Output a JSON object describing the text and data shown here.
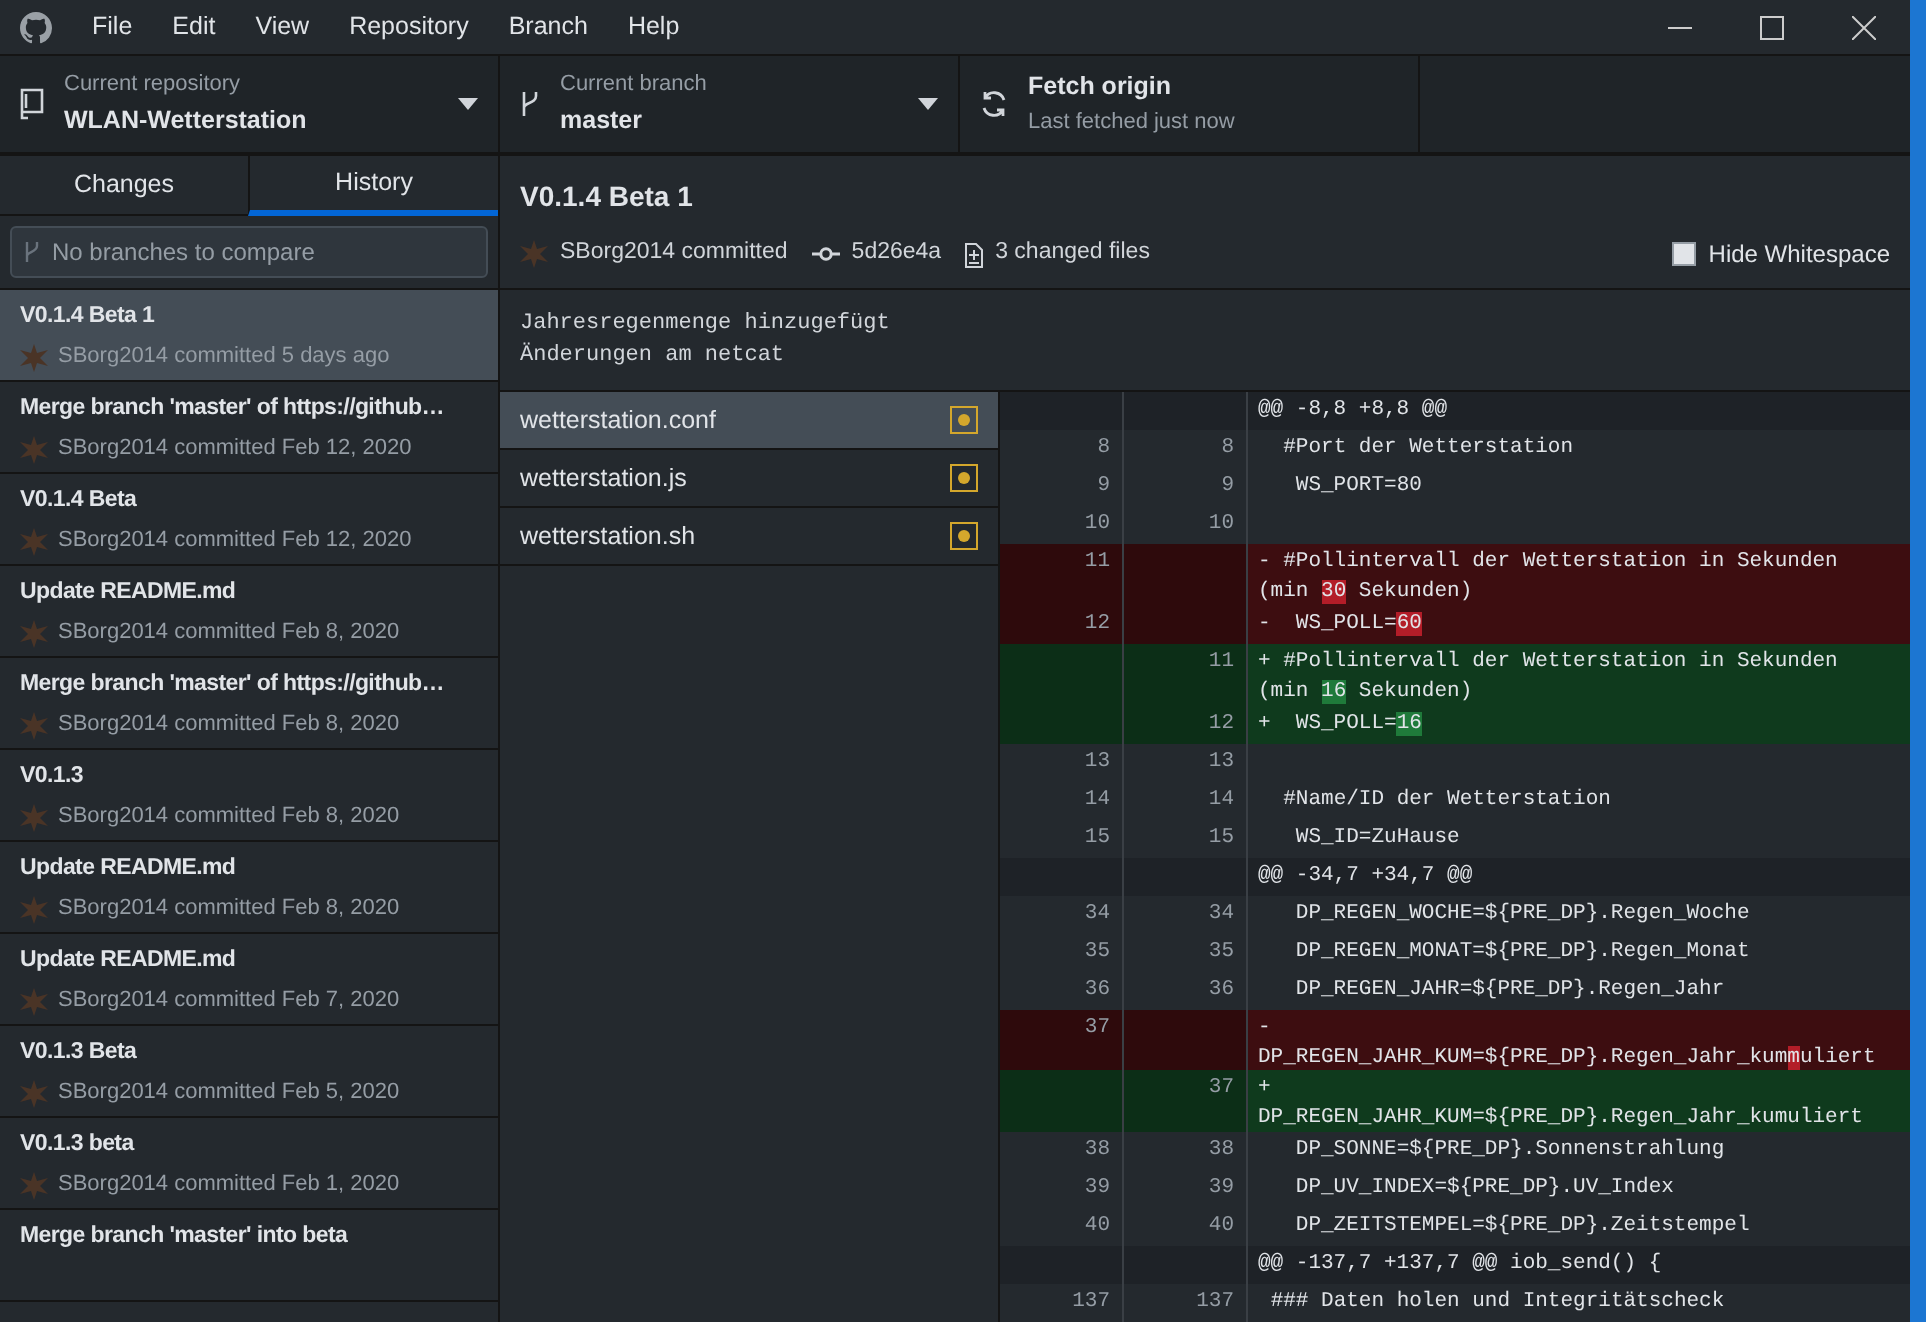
{
  "menu": [
    "File",
    "Edit",
    "View",
    "Repository",
    "Branch",
    "Help"
  ],
  "toolbar": {
    "repository": {
      "label": "Current repository",
      "value": "WLAN-Wetterstation"
    },
    "branch": {
      "label": "Current branch",
      "value": "master"
    },
    "fetch": {
      "title": "Fetch origin",
      "subtitle": "Last fetched just now"
    }
  },
  "tabs": [
    {
      "label": "Changes",
      "selected": false
    },
    {
      "label": "History",
      "selected": true
    }
  ],
  "branch_filter": {
    "placeholder": "No branches to compare"
  },
  "commits": [
    {
      "title": "V0.1.4 Beta 1",
      "meta": "SBorg2014 committed 5 days ago",
      "selected": true
    },
    {
      "title": "Merge branch 'master' of https://github…",
      "meta": "SBorg2014 committed Feb 12, 2020",
      "selected": false
    },
    {
      "title": "V0.1.4 Beta",
      "meta": "SBorg2014 committed Feb 12, 2020",
      "selected": false
    },
    {
      "title": "Update README.md",
      "meta": "SBorg2014 committed Feb 8, 2020",
      "selected": false
    },
    {
      "title": "Merge branch 'master' of https://github…",
      "meta": "SBorg2014 committed Feb 8, 2020",
      "selected": false
    },
    {
      "title": "V0.1.3",
      "meta": "SBorg2014 committed Feb 8, 2020",
      "selected": false
    },
    {
      "title": "Update README.md",
      "meta": "SBorg2014 committed Feb 8, 2020",
      "selected": false
    },
    {
      "title": "Update README.md",
      "meta": "SBorg2014 committed Feb 7, 2020",
      "selected": false
    },
    {
      "title": "V0.1.3 Beta",
      "meta": "SBorg2014 committed Feb 5, 2020",
      "selected": false
    },
    {
      "title": "V0.1.3 beta",
      "meta": "SBorg2014 committed Feb 1, 2020",
      "selected": false
    },
    {
      "title": "Merge branch 'master' into beta",
      "selected": false
    }
  ],
  "commit": {
    "title": "V0.1.4 Beta 1",
    "author": "SBorg2014 committed",
    "sha": "5d26e4a",
    "files_changed": "3 changed files",
    "hide_whitespace": {
      "label": "Hide Whitespace",
      "checked": false
    },
    "message_lines": [
      "Jahresregenmenge hinzugefügt",
      "Änderungen am netcat"
    ]
  },
  "files": [
    {
      "name": "wetterstation.conf",
      "selected": true
    },
    {
      "name": "wetterstation.js",
      "selected": false
    },
    {
      "name": "wetterstation.sh",
      "selected": false
    }
  ],
  "diff": [
    {
      "kind": "hunk",
      "text": "@@ -8,8 +8,8 @@"
    },
    {
      "kind": "context",
      "old": "8",
      "new": "8",
      "text": "  #Port der Wetterstation"
    },
    {
      "kind": "context",
      "old": "9",
      "new": "9",
      "text": "   WS_PORT=80"
    },
    {
      "kind": "context",
      "old": "10",
      "new": "10"
    },
    {
      "kind": "deleted",
      "old": "11",
      "parts": [
        {
          "text": "- #Pollintervall der Wetterstation in Sekunden (min ",
          "highlight": false
        },
        {
          "text": "30",
          "highlight": true
        },
        {
          "text": " Sekunden)",
          "highlight": false
        }
      ]
    },
    {
      "kind": "deleted",
      "old": "12",
      "parts": [
        {
          "text": "-  WS_POLL=",
          "highlight": false
        },
        {
          "text": "60",
          "highlight": true
        }
      ]
    },
    {
      "kind": "added",
      "new": "11",
      "parts": [
        {
          "text": "+ #Pollintervall der Wetterstation in Sekunden (min ",
          "highlight": false
        },
        {
          "text": "16",
          "highlight": true
        },
        {
          "text": " Sekunden)",
          "highlight": false
        }
      ]
    },
    {
      "kind": "added",
      "new": "12",
      "parts": [
        {
          "text": "+  WS_POLL=",
          "highlight": false
        },
        {
          "text": "16",
          "highlight": true
        }
      ]
    },
    {
      "kind": "context",
      "old": "13",
      "new": "13"
    },
    {
      "kind": "context",
      "old": "14",
      "new": "14",
      "text": "  #Name/ID der Wetterstation"
    },
    {
      "kind": "context",
      "old": "15",
      "new": "15",
      "text": "   WS_ID=ZuHause"
    },
    {
      "kind": "hunk",
      "text": "@@ -34,7 +34,7 @@"
    },
    {
      "kind": "context",
      "old": "34",
      "new": "34",
      "text": "   DP_REGEN_WOCHE=${PRE_DP}.Regen_Woche"
    },
    {
      "kind": "context",
      "old": "35",
      "new": "35",
      "text": "   DP_REGEN_MONAT=${PRE_DP}.Regen_Monat"
    },
    {
      "kind": "context",
      "old": "36",
      "new": "36",
      "text": "   DP_REGEN_JAHR=${PRE_DP}.Regen_Jahr"
    },
    {
      "kind": "deleted",
      "old": "37",
      "parts": [
        {
          "text": "-  DP_REGEN_JAHR_KUM=${PRE_DP}.Regen_Jahr_kum",
          "highlight": false
        },
        {
          "text": "m",
          "highlight": true
        },
        {
          "text": "uliert",
          "highlight": false
        }
      ]
    },
    {
      "kind": "added",
      "new": "37",
      "text": "+  DP_REGEN_JAHR_KUM=${PRE_DP}.Regen_Jahr_kumuliert"
    },
    {
      "kind": "context",
      "old": "38",
      "new": "38",
      "text": "   DP_SONNE=${PRE_DP}.Sonnenstrahlung"
    },
    {
      "kind": "context",
      "old": "39",
      "new": "39",
      "text": "   DP_UV_INDEX=${PRE_DP}.UV_Index"
    },
    {
      "kind": "context",
      "old": "40",
      "new": "40",
      "text": "   DP_ZEITSTEMPEL=${PRE_DP}.Zeitstempel"
    },
    {
      "kind": "hunk",
      "text": "@@ -137,7 +137,7 @@ iob_send() {"
    },
    {
      "kind": "context",
      "old": "137",
      "new": "137",
      "text": " ### Daten holen und Integritätscheck"
    }
  ]
}
